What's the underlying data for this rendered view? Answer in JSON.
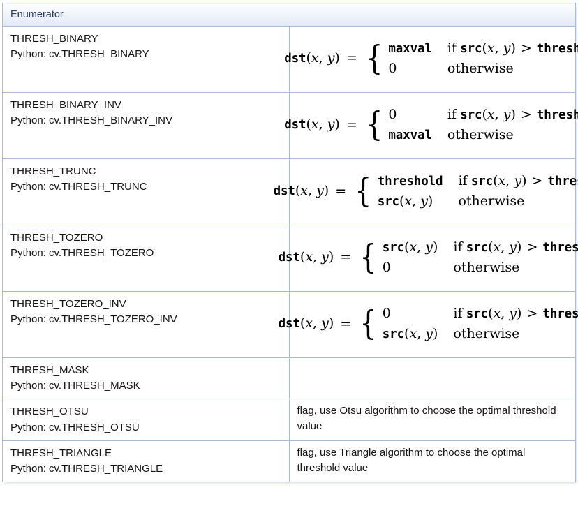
{
  "table": {
    "header": {
      "enumerator_label": "Enumerator"
    },
    "colors": {
      "border": "#a8bbdd",
      "header_text": "#283a5d",
      "header_bg_top": "#fdfdfe",
      "header_bg_bottom": "#e2e8f4",
      "body_text": "#141414",
      "cell_bg": "#ffffff"
    },
    "rows": [
      {
        "name": "THRESH_BINARY",
        "python": "Python: cv.THRESH_BINARY",
        "kind": "formula",
        "formula": {
          "lhs_fn": "dst",
          "lhs_args": "(x, y)",
          "case1_value": "maxval",
          "case1_value_style": "tt",
          "case1_cond": "if src(x, y) > thresh",
          "case2_value": "0",
          "case2_value_style": "rm",
          "case2_cond": "otherwise"
        }
      },
      {
        "name": "THRESH_BINARY_INV",
        "python": "Python: cv.THRESH_BINARY_INV",
        "kind": "formula",
        "formula": {
          "lhs_fn": "dst",
          "lhs_args": "(x, y)",
          "case1_value": "0",
          "case1_value_style": "rm",
          "case1_cond": "if src(x, y) > thresh",
          "case2_value": "maxval",
          "case2_value_style": "tt",
          "case2_cond": "otherwise"
        }
      },
      {
        "name": "THRESH_TRUNC",
        "python": "Python: cv.THRESH_TRUNC",
        "kind": "formula",
        "formula": {
          "lhs_fn": "dst",
          "lhs_args": "(x, y)",
          "case1_value": "threshold",
          "case1_value_style": "tt",
          "case1_cond": "if src(x, y) > thresh",
          "case2_value": "src(x, y)",
          "case2_value_style": "fn",
          "case2_cond": "otherwise"
        }
      },
      {
        "name": "THRESH_TOZERO",
        "python": "Python: cv.THRESH_TOZERO",
        "kind": "formula",
        "formula": {
          "lhs_fn": "dst",
          "lhs_args": "(x, y)",
          "case1_value": "src(x, y)",
          "case1_value_style": "fn",
          "case1_cond": "if src(x, y) > thresh",
          "case2_value": "0",
          "case2_value_style": "rm",
          "case2_cond": "otherwise"
        }
      },
      {
        "name": "THRESH_TOZERO_INV",
        "python": "Python: cv.THRESH_TOZERO_INV",
        "kind": "formula",
        "formula": {
          "lhs_fn": "dst",
          "lhs_args": "(x, y)",
          "case1_value": "0",
          "case1_value_style": "rm",
          "case1_cond": "if src(x, y) > thresh",
          "case2_value": "src(x, y)",
          "case2_value_style": "fn",
          "case2_cond": "otherwise"
        }
      },
      {
        "name": "THRESH_MASK",
        "python": "Python: cv.THRESH_MASK",
        "kind": "empty",
        "description": ""
      },
      {
        "name": "THRESH_OTSU",
        "python": "Python: cv.THRESH_OTSU",
        "kind": "text",
        "description": "flag, use Otsu algorithm to choose the optimal threshold value"
      },
      {
        "name": "THRESH_TRIANGLE",
        "python": "Python: cv.THRESH_TRIANGLE",
        "kind": "text",
        "description": "flag, use Triangle algorithm to choose the optimal threshold value"
      }
    ]
  }
}
